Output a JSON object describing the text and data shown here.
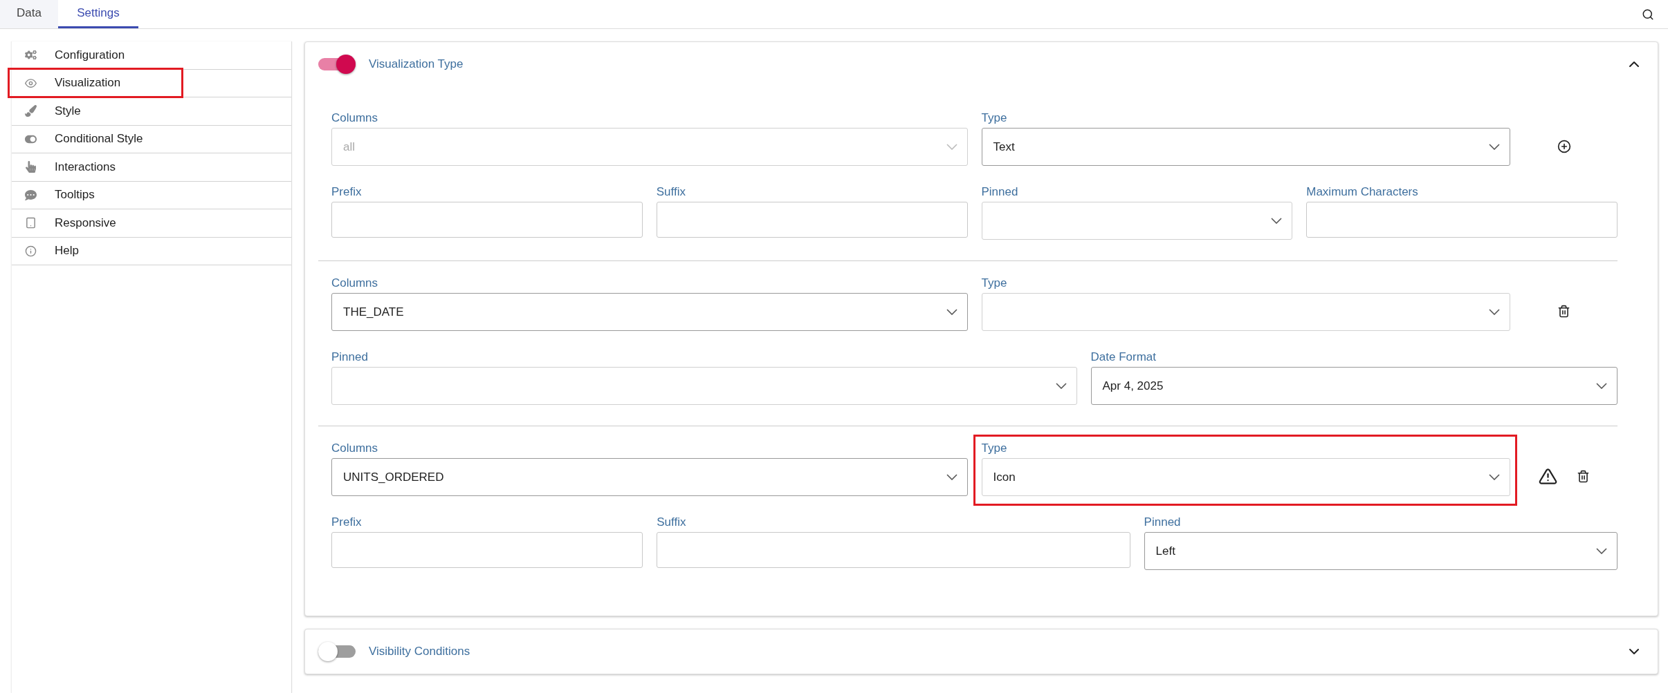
{
  "tabs": [
    {
      "label": "Data",
      "selected": false
    },
    {
      "label": "Settings",
      "selected": true
    }
  ],
  "sidebar": {
    "items": [
      {
        "label": "Configuration",
        "highlighted": false
      },
      {
        "label": "Visualization",
        "highlighted": true
      },
      {
        "label": "Style",
        "highlighted": false
      },
      {
        "label": "Conditional Style",
        "highlighted": false
      },
      {
        "label": "Interactions",
        "highlighted": false
      },
      {
        "label": "Tooltips",
        "highlighted": false
      },
      {
        "label": "Responsive",
        "highlighted": false
      },
      {
        "label": "Help",
        "highlighted": false
      }
    ]
  },
  "panels": [
    {
      "title": "Visualization Type",
      "on": true,
      "expanded": true,
      "groups": [
        {
          "actions": [
            {
              "kind": "add"
            }
          ],
          "lines": [
            {
              "fields": [
                {
                  "label": "Columns",
                  "kind": "select",
                  "value": "all",
                  "disabled": true
                },
                {
                  "label": "Type",
                  "kind": "select",
                  "value": "Text"
                }
              ]
            },
            {
              "fields": [
                {
                  "label": "Prefix",
                  "kind": "text"
                },
                {
                  "label": "Suffix",
                  "kind": "text"
                },
                {
                  "label": "Pinned",
                  "kind": "select"
                },
                {
                  "label": "Maximum Characters",
                  "kind": "text"
                }
              ]
            }
          ]
        },
        {
          "actions": [
            {
              "kind": "delete"
            }
          ],
          "lines": [
            {
              "fields": [
                {
                  "label": "Columns",
                  "kind": "select",
                  "value": "THE_DATE"
                },
                {
                  "label": "Type",
                  "kind": "select"
                }
              ]
            },
            {
              "fields": [
                {
                  "label": "Pinned",
                  "kind": "select"
                },
                {
                  "label": "Date Format",
                  "kind": "select",
                  "value": "Apr 4, 2025"
                }
              ]
            }
          ]
        },
        {
          "actions": [
            {
              "kind": "warning"
            },
            {
              "kind": "delete"
            }
          ],
          "lines": [
            {
              "fields": [
                {
                  "label": "Columns",
                  "kind": "select",
                  "value": "UNITS_ORDERED"
                },
                {
                  "label": "Type",
                  "kind": "select",
                  "value": "Icon",
                  "highlighted": true
                }
              ]
            },
            {
              "fields": [
                {
                  "label": "Prefix",
                  "kind": "text"
                },
                {
                  "label": "Suffix",
                  "kind": "text"
                },
                {
                  "label": "Pinned",
                  "kind": "select",
                  "value": "Left"
                }
              ]
            }
          ]
        }
      ]
    },
    {
      "title": "Visibility Conditions",
      "on": false,
      "expanded": false
    }
  ]
}
